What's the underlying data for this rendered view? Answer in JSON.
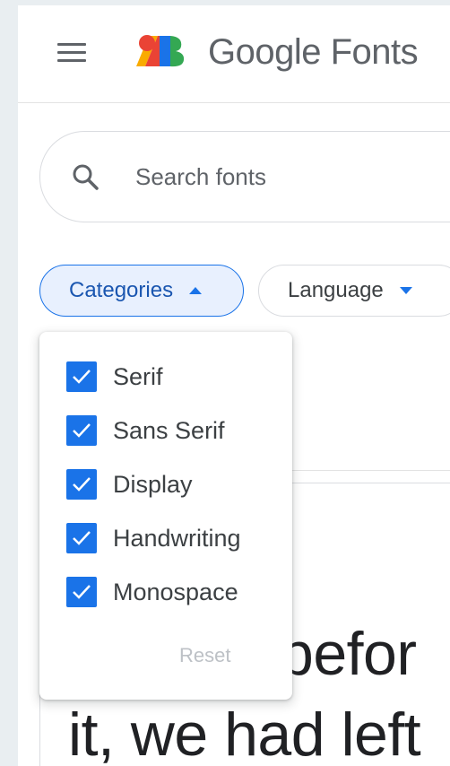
{
  "header": {
    "brand": "Google Fonts",
    "menu_icon": "hamburger-menu-icon",
    "logo_icon": "google-fonts-logo"
  },
  "search": {
    "placeholder": "Search fonts",
    "value": "",
    "icon": "search-icon"
  },
  "filters": {
    "categories_label": "Categories",
    "categories_expanded": true,
    "language_label": "Language"
  },
  "categories_menu": {
    "options": [
      {
        "label": "Serif",
        "checked": true
      },
      {
        "label": "Sans Serif",
        "checked": true
      },
      {
        "label": "Display",
        "checked": true
      },
      {
        "label": "Handwriting",
        "checked": true
      },
      {
        "label": "Monospace",
        "checked": true
      }
    ],
    "reset_label": "Reset"
  },
  "preview": {
    "line1": "befor",
    "line2": "it, we had left"
  },
  "colors": {
    "accent": "#1a73e8",
    "chip_active_bg": "#e8f0fe",
    "text": "#3c4043",
    "muted": "#5f6368",
    "disabled": "#bdc1c6"
  }
}
